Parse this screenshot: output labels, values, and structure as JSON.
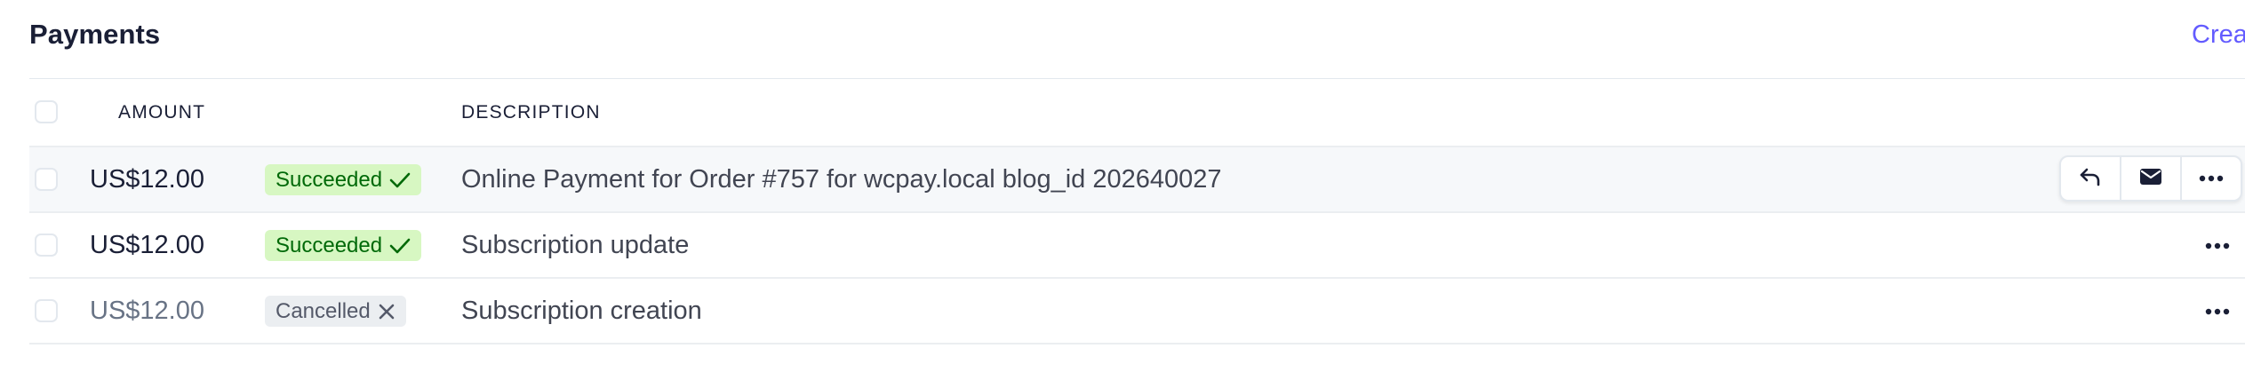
{
  "page": {
    "title": "Payments",
    "create_label": "Create"
  },
  "table": {
    "headers": {
      "amount": "AMOUNT",
      "description": "DESCRIPTION"
    },
    "rows": [
      {
        "amount": "US$12.00",
        "status": "Succeeded",
        "status_icon": "check-icon",
        "description": "Online Payment for Order #757 for wcpay.local blog_id 202640027",
        "hovered": true
      },
      {
        "amount": "US$12.00",
        "status": "Succeeded",
        "status_icon": "check-icon",
        "description": "Subscription update",
        "hovered": false
      },
      {
        "amount": "US$12.00",
        "status": "Cancelled",
        "status_icon": "close-icon",
        "description": "Subscription creation",
        "hovered": false
      }
    ],
    "row_actions": [
      "refund-icon",
      "email-icon",
      "more-icon"
    ]
  },
  "colors": {
    "accent": "#635bff",
    "success_bg": "#d7f7c2",
    "success_text": "#006908",
    "cancel_bg": "#ebeef1",
    "cancel_text": "#545969",
    "row_hover_bg": "#f6f8fa"
  }
}
